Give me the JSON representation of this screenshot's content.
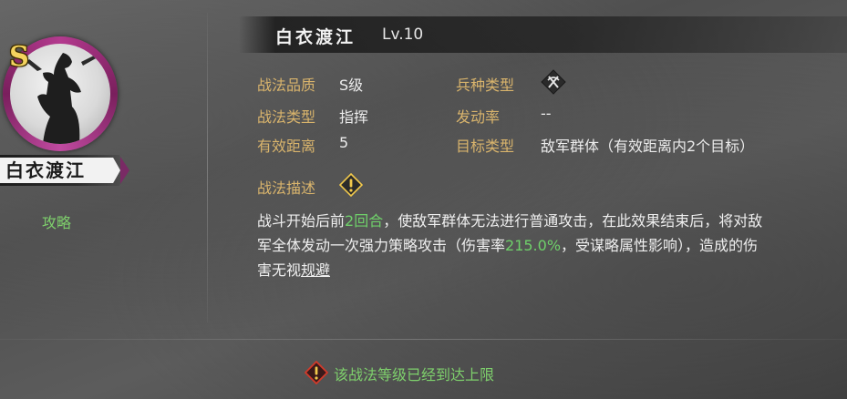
{
  "portrait": {
    "grade": "S",
    "name": "白衣渡江",
    "strategy_link": "攻略"
  },
  "header": {
    "title": "白衣渡江",
    "level": "Lv.10"
  },
  "attributes": {
    "quality_label": "战法品质",
    "quality_value": "S级",
    "troop_type_label": "兵种类型",
    "troop_type_icon": "bow-cross-icon",
    "skill_type_label": "战法类型",
    "skill_type_value": "指挥",
    "trigger_rate_label": "发动率",
    "trigger_rate_value": "--",
    "range_label": "有效距离",
    "range_value": "5",
    "target_label": "目标类型",
    "target_value": "敌军群体（有效距离内2个目标）"
  },
  "description": {
    "label": "战法描述",
    "line1_a": "战斗开始后前",
    "line1_hl": "2回合",
    "line1_b": "，使敌军群体无法进行普通攻击，在此效果结束后，将对敌",
    "line2_a": "军全体发动一次强力策略攻击（伤害率",
    "line2_hl": "215.0%",
    "line2_b": "，受谋略属性影响），造成的伤",
    "line3_a": "害无视",
    "line3_u": "规避"
  },
  "footer": {
    "note": "该战法等级已经到达上限"
  },
  "colors": {
    "label_gold": "#d9b46c",
    "highlight_green": "#6fd06a",
    "portrait_ring": "#b33a8e",
    "warning_yellow": "#f2c94c"
  }
}
